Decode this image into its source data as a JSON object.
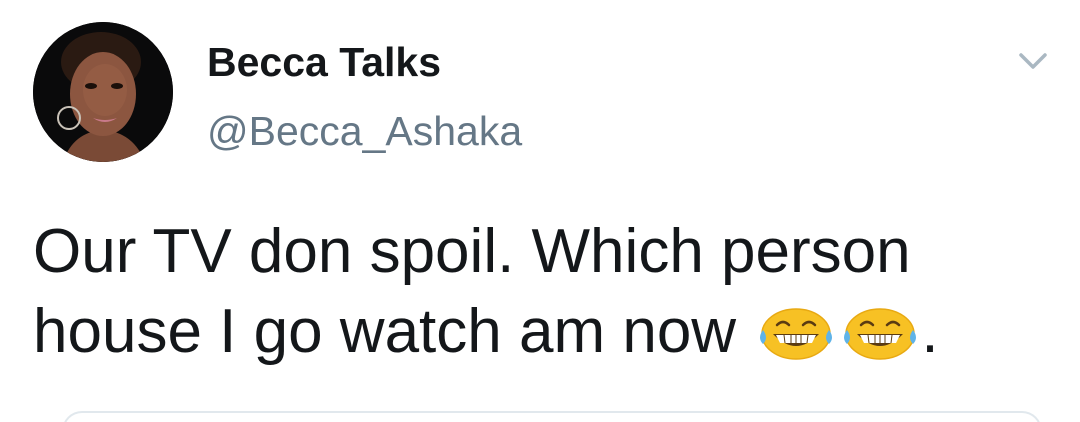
{
  "tweet": {
    "display_name": "Becca Talks",
    "handle": "@Becca_Ashaka",
    "text_line1": "Our TV don spoil. Which person",
    "text_line2": "house I go watch am now",
    "text_trailing": ".",
    "emojis": [
      "laughing-with-tears-emoji",
      "laughing-with-tears-emoji"
    ],
    "avatar_alt_icon": "profile-photo",
    "menu_icon": "chevron-down-icon"
  },
  "colors": {
    "name": "#14171a",
    "handle": "#657786",
    "text": "#14171a",
    "caret": "#aab8c2",
    "emoji_face": "#f7c124",
    "divider": "#e1e8ed"
  }
}
